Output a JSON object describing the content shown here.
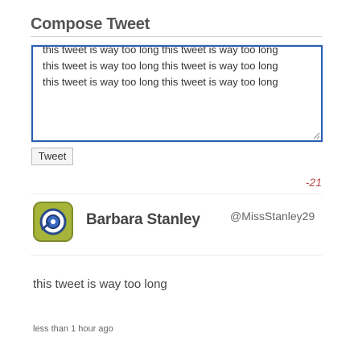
{
  "header": {
    "title": "Compose Tweet"
  },
  "compose": {
    "text": "this tweet is way too long this tweet is way too long\nthis tweet is way too long this tweet is way too long\nthis tweet is way too long this tweet is way too long",
    "button_label": "Tweet",
    "remaining_chars": "-21"
  },
  "tweet": {
    "user_name": "Barbara Stanley",
    "user_handle": "@MissStanley29",
    "text": "this tweet is way too long",
    "timestamp": "less than 1 hour ago",
    "avatar_icon": "avatar-icon"
  },
  "colors": {
    "textarea_border": "#2b5fb3",
    "char_count_negative": "#b94a48",
    "avatar_bg": "#a6b43a"
  }
}
